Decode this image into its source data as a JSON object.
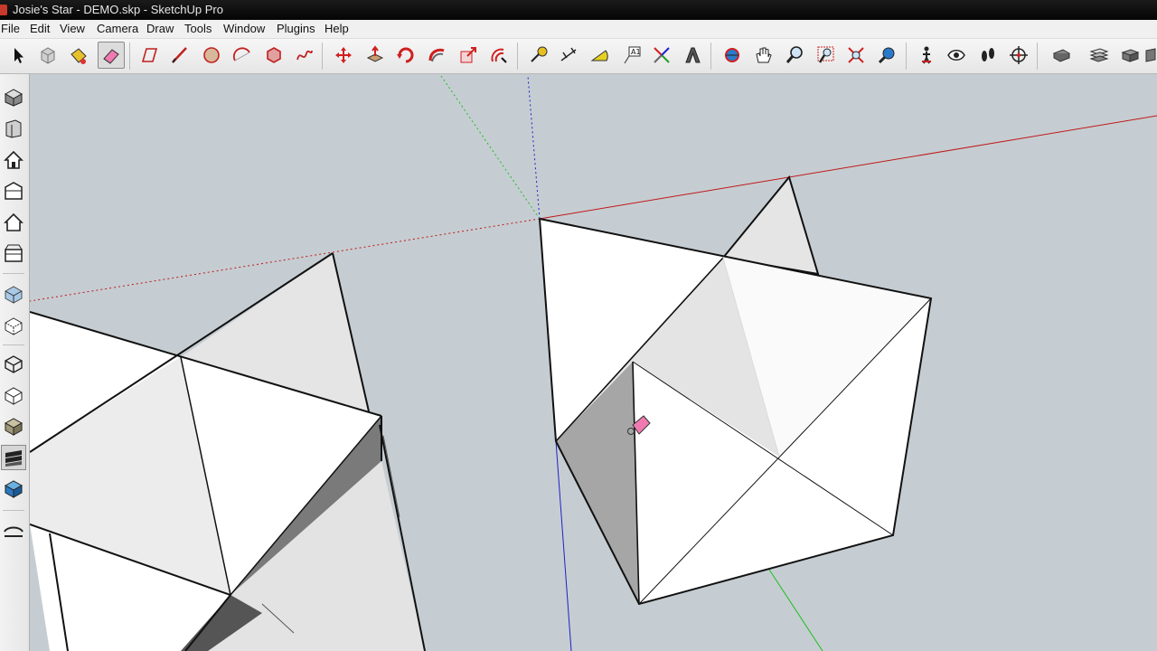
{
  "window": {
    "title": "Josie's Star - DEMO.skp - SketchUp Pro"
  },
  "menu": [
    "File",
    "Edit",
    "View",
    "Camera",
    "Draw",
    "Tools",
    "Window",
    "Plugins",
    "Help"
  ],
  "toolbar_icons": [
    "select-icon",
    "make-component-icon",
    "paint-bucket-icon",
    "eraser-icon",
    "rectangle-icon",
    "line-icon",
    "circle-icon",
    "arc-icon",
    "polygon-icon",
    "freehand-icon",
    "move-icon",
    "push-pull-icon",
    "rotate-icon",
    "follow-me-icon",
    "scale-icon",
    "offset-icon",
    "tape-measure-icon",
    "dimension-icon",
    "protractor-icon",
    "text-icon",
    "axes-icon",
    "3d-text-icon",
    "orbit-icon",
    "pan-icon",
    "zoom-icon",
    "zoom-window-icon",
    "zoom-extents-icon",
    "previous-view-icon",
    "position-camera-icon",
    "look-around-icon",
    "walk-icon",
    "section-plane-icon",
    "outliner-icon",
    "layers-icon",
    "components-icon"
  ],
  "left_toolbar_icons": [
    "iso-view-icon",
    "top-view-icon",
    "front-view-icon",
    "right-view-icon",
    "back-view-icon",
    "left-view-icon",
    "xray-icon",
    "back-edges-icon",
    "wireframe-icon",
    "hidden-line-icon",
    "shaded-icon",
    "shaded-textures-icon",
    "monochrome-icon",
    "sandbox-icon"
  ],
  "colors": {
    "red_axis": "#c01818",
    "green_axis": "#1fbf1f",
    "blue_axis": "#2020c8",
    "sky": "#c5cdd2",
    "eraser": "#f07ab0"
  }
}
